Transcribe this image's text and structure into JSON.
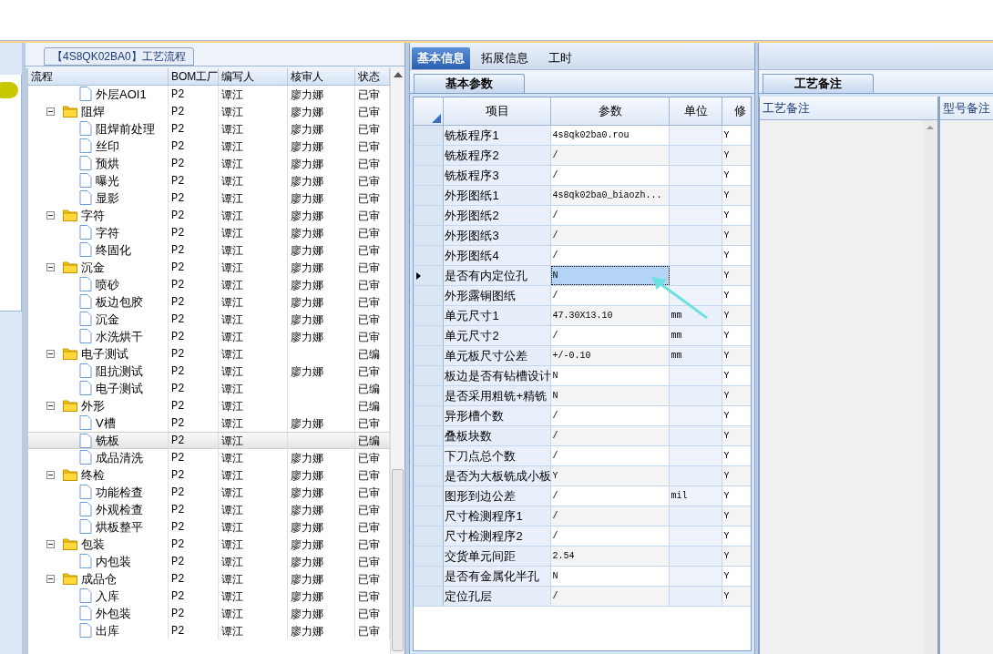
{
  "process_panel": {
    "title": "【4S8QK02BA0】工艺流程",
    "columns": [
      "流程",
      "BOM工厂",
      "编写人",
      "核审人",
      "状态"
    ],
    "tree": [
      {
        "kind": "file",
        "name": "外层AOI1",
        "factory": "P2",
        "writer": "谭江",
        "reviewer": "廖力娜",
        "status": "已审",
        "selected": false
      },
      {
        "kind": "folder",
        "name": "阻焊",
        "factory": "P2",
        "writer": "谭江",
        "reviewer": "廖力娜",
        "status": "已审",
        "selected": false,
        "expanded": true,
        "children": [
          {
            "kind": "file",
            "name": "阻焊前处理",
            "factory": "P2",
            "writer": "谭江",
            "reviewer": "廖力娜",
            "status": "已审",
            "selected": false
          },
          {
            "kind": "file",
            "name": "丝印",
            "factory": "P2",
            "writer": "谭江",
            "reviewer": "廖力娜",
            "status": "已审",
            "selected": false
          },
          {
            "kind": "file",
            "name": "预烘",
            "factory": "P2",
            "writer": "谭江",
            "reviewer": "廖力娜",
            "status": "已审",
            "selected": false
          },
          {
            "kind": "file",
            "name": "曝光",
            "factory": "P2",
            "writer": "谭江",
            "reviewer": "廖力娜",
            "status": "已审",
            "selected": false
          },
          {
            "kind": "file",
            "name": "显影",
            "factory": "P2",
            "writer": "谭江",
            "reviewer": "廖力娜",
            "status": "已审",
            "selected": false
          }
        ]
      },
      {
        "kind": "folder",
        "name": "字符",
        "factory": "P2",
        "writer": "谭江",
        "reviewer": "廖力娜",
        "status": "已审",
        "selected": false,
        "expanded": true,
        "children": [
          {
            "kind": "file",
            "name": "字符",
            "factory": "P2",
            "writer": "谭江",
            "reviewer": "廖力娜",
            "status": "已审",
            "selected": false
          },
          {
            "kind": "file",
            "name": "终固化",
            "factory": "P2",
            "writer": "谭江",
            "reviewer": "廖力娜",
            "status": "已审",
            "selected": false
          }
        ]
      },
      {
        "kind": "folder",
        "name": "沉金",
        "factory": "P2",
        "writer": "谭江",
        "reviewer": "廖力娜",
        "status": "已审",
        "selected": false,
        "expanded": true,
        "children": [
          {
            "kind": "file",
            "name": "喷砂",
            "factory": "P2",
            "writer": "谭江",
            "reviewer": "廖力娜",
            "status": "已审",
            "selected": false
          },
          {
            "kind": "file",
            "name": "板边包胶",
            "factory": "P2",
            "writer": "谭江",
            "reviewer": "廖力娜",
            "status": "已审",
            "selected": false
          },
          {
            "kind": "file",
            "name": "沉金",
            "factory": "P2",
            "writer": "谭江",
            "reviewer": "廖力娜",
            "status": "已审",
            "selected": false
          },
          {
            "kind": "file",
            "name": "水洗烘干",
            "factory": "P2",
            "writer": "谭江",
            "reviewer": "廖力娜",
            "status": "已审",
            "selected": false
          }
        ]
      },
      {
        "kind": "folder",
        "name": "电子测试",
        "factory": "P2",
        "writer": "谭江",
        "status": "已编",
        "selected": false,
        "expanded": true,
        "children": [
          {
            "kind": "file",
            "name": "阻抗测试",
            "factory": "P2",
            "writer": "谭江",
            "reviewer": "廖力娜",
            "status": "已审",
            "selected": false
          },
          {
            "kind": "file",
            "name": "电子测试",
            "factory": "P2",
            "writer": "谭江",
            "status": "已编",
            "selected": false
          }
        ]
      },
      {
        "kind": "folder",
        "name": "外形",
        "factory": "P2",
        "writer": "谭江",
        "status": "已编",
        "selected": false,
        "expanded": true,
        "children": [
          {
            "kind": "file",
            "name": "V槽",
            "factory": "P2",
            "writer": "谭江",
            "reviewer": "廖力娜",
            "status": "已审",
            "selected": false
          },
          {
            "kind": "file",
            "name": "铣板",
            "factory": "P2",
            "writer": "谭江",
            "status": "已编",
            "selected": true
          },
          {
            "kind": "file",
            "name": "成品清洗",
            "factory": "P2",
            "writer": "谭江",
            "reviewer": "廖力娜",
            "status": "已审",
            "selected": false
          }
        ]
      },
      {
        "kind": "folder",
        "name": "终检",
        "factory": "P2",
        "writer": "谭江",
        "reviewer": "廖力娜",
        "status": "已审",
        "selected": false,
        "expanded": true,
        "children": [
          {
            "kind": "file",
            "name": "功能检查",
            "factory": "P2",
            "writer": "谭江",
            "reviewer": "廖力娜",
            "status": "已审",
            "selected": false
          },
          {
            "kind": "file",
            "name": "外观检查",
            "factory": "P2",
            "writer": "谭江",
            "reviewer": "廖力娜",
            "status": "已审",
            "selected": false
          },
          {
            "kind": "file",
            "name": "烘板整平",
            "factory": "P2",
            "writer": "谭江",
            "reviewer": "廖力娜",
            "status": "已审",
            "selected": false
          }
        ]
      },
      {
        "kind": "folder",
        "name": "包装",
        "factory": "P2",
        "writer": "谭江",
        "reviewer": "廖力娜",
        "status": "已审",
        "selected": false,
        "expanded": true,
        "children": [
          {
            "kind": "file",
            "name": "内包装",
            "factory": "P2",
            "writer": "谭江",
            "reviewer": "廖力娜",
            "status": "已审",
            "selected": false
          }
        ]
      },
      {
        "kind": "folder",
        "name": "成品仓",
        "factory": "P2",
        "writer": "谭江",
        "reviewer": "廖力娜",
        "status": "已审",
        "selected": false,
        "expanded": true,
        "children": [
          {
            "kind": "file",
            "name": "入库",
            "factory": "P2",
            "writer": "谭江",
            "reviewer": "廖力娜",
            "status": "已审",
            "selected": false
          },
          {
            "kind": "file",
            "name": "外包装",
            "factory": "P2",
            "writer": "谭江",
            "reviewer": "廖力娜",
            "status": "已审",
            "selected": false
          },
          {
            "kind": "file",
            "name": "出库",
            "factory": "P2",
            "writer": "谭江",
            "reviewer": "廖力娜",
            "status": "已审",
            "selected": false
          }
        ]
      }
    ]
  },
  "info_panel": {
    "tabs": [
      {
        "label": "基本信息",
        "selected": true
      },
      {
        "label": "拓展信息",
        "selected": false
      },
      {
        "label": "工时",
        "selected": false
      }
    ],
    "subtab": "基本参数",
    "columns": [
      "项目",
      "参数",
      "单位",
      "修"
    ],
    "rows": [
      {
        "item": "铣板程序1",
        "value": "4s8qk02ba0.rou",
        "unit": "",
        "modified": "Y",
        "selected": false
      },
      {
        "item": "铣板程序2",
        "value": "/",
        "unit": "",
        "modified": "Y",
        "selected": false
      },
      {
        "item": "铣板程序3",
        "value": "/",
        "unit": "",
        "modified": "Y",
        "selected": false
      },
      {
        "item": "外形图纸1",
        "value": "4s8qk02ba0_biaozh...",
        "unit": "",
        "modified": "Y",
        "selected": false
      },
      {
        "item": "外形图纸2",
        "value": "/",
        "unit": "",
        "modified": "Y",
        "selected": false
      },
      {
        "item": "外形图纸3",
        "value": "/",
        "unit": "",
        "modified": "Y",
        "selected": false
      },
      {
        "item": "外形图纸4",
        "value": "/",
        "unit": "",
        "modified": "Y",
        "selected": false
      },
      {
        "item": "是否有内定位孔",
        "value": "N",
        "unit": "",
        "modified": "Y",
        "selected": true
      },
      {
        "item": "外形露铜图纸",
        "value": "/",
        "unit": "",
        "modified": "Y",
        "selected": false
      },
      {
        "item": "单元尺寸1",
        "value": "47.30X13.10",
        "unit": "mm",
        "modified": "Y",
        "selected": false
      },
      {
        "item": "单元尺寸2",
        "value": "/",
        "unit": "mm",
        "modified": "Y",
        "selected": false
      },
      {
        "item": "单元板尺寸公差",
        "value": "+/-0.10",
        "unit": "mm",
        "modified": "Y",
        "selected": false
      },
      {
        "item": "板边是否有钻槽设计",
        "value": "N",
        "unit": "",
        "modified": "Y",
        "selected": false
      },
      {
        "item": "是否采用粗铣+精铣",
        "value": "N",
        "unit": "",
        "modified": "Y",
        "selected": false
      },
      {
        "item": "异形槽个数",
        "value": "/",
        "unit": "",
        "modified": "Y",
        "selected": false
      },
      {
        "item": "叠板块数",
        "value": "/",
        "unit": "",
        "modified": "Y",
        "selected": false
      },
      {
        "item": "下刀点总个数",
        "value": "/",
        "unit": "",
        "modified": "Y",
        "selected": false
      },
      {
        "item": "是否为大板铣成小板",
        "value": "Y",
        "unit": "",
        "modified": "Y",
        "selected": false
      },
      {
        "item": "图形到边公差",
        "value": "/",
        "unit": "mil",
        "modified": "Y",
        "selected": false
      },
      {
        "item": "尺寸检测程序1",
        "value": "/",
        "unit": "",
        "modified": "Y",
        "selected": false
      },
      {
        "item": "尺寸检测程序2",
        "value": "/",
        "unit": "",
        "modified": "Y",
        "selected": false
      },
      {
        "item": "交货单元间距",
        "value": "2.54",
        "unit": "",
        "modified": "Y",
        "selected": false
      },
      {
        "item": "是否有金属化半孔",
        "value": "N",
        "unit": "",
        "modified": "Y",
        "selected": false
      },
      {
        "item": "定位孔层",
        "value": "/",
        "unit": "",
        "modified": "Y",
        "selected": false
      }
    ]
  },
  "notes_panel": {
    "tab": "工艺备注",
    "columns": [
      "工艺备注",
      "型号备注"
    ]
  }
}
